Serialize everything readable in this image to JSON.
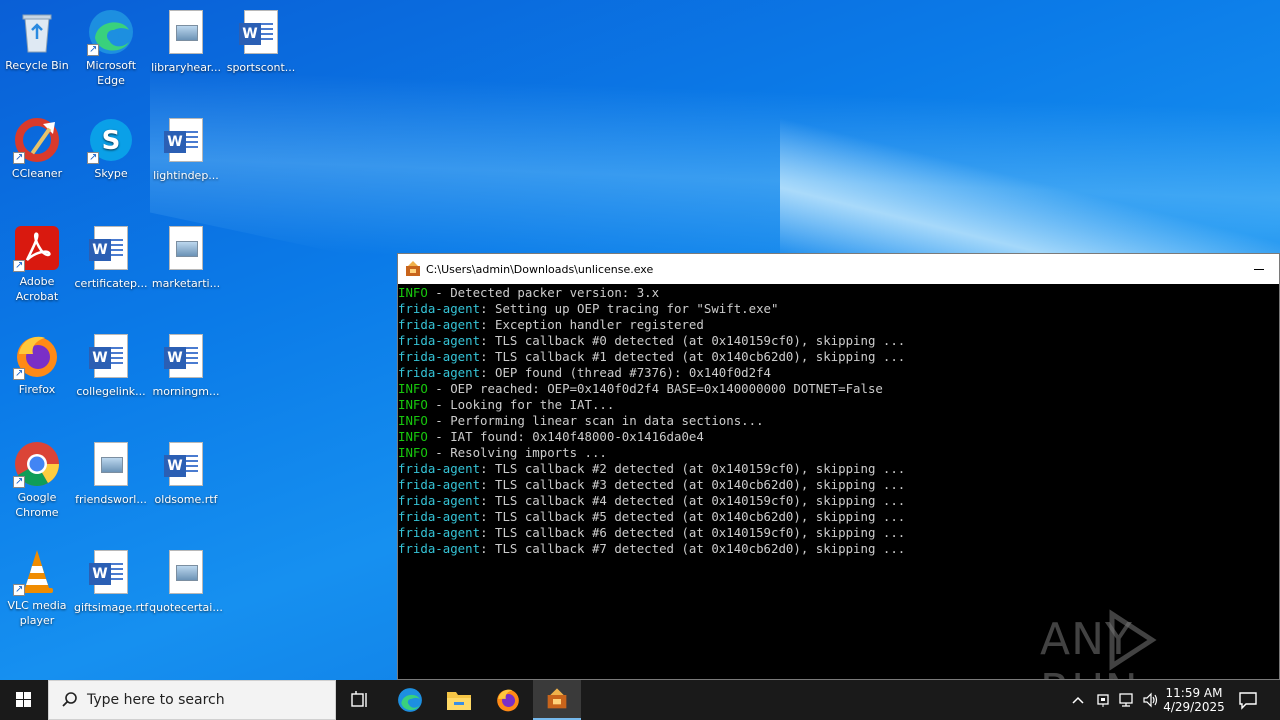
{
  "desktop": {
    "icons": [
      {
        "label": "Recycle Bin"
      },
      {
        "label": "Microsoft Edge"
      },
      {
        "label": "libraryhear..."
      },
      {
        "label": "sportscont..."
      },
      {
        "label": "CCleaner"
      },
      {
        "label": "Skype"
      },
      {
        "label": "lightindep..."
      },
      {
        "label": "Adobe Acrobat"
      },
      {
        "label": "certificatep..."
      },
      {
        "label": "marketarti..."
      },
      {
        "label": "Firefox"
      },
      {
        "label": "collegelink..."
      },
      {
        "label": "morningm..."
      },
      {
        "label": "Google Chrome"
      },
      {
        "label": "friendsworl..."
      },
      {
        "label": "oldsome.rtf"
      },
      {
        "label": "VLC media player"
      },
      {
        "label": "giftsimage.rtf"
      },
      {
        "label": "quotecertai..."
      }
    ]
  },
  "console": {
    "title": "C:\\Users\\admin\\Downloads\\unlicense.exe",
    "lines": [
      {
        "tag": "INFO",
        "text": " - Detected packer version: 3.x"
      },
      {
        "tag": "frida-agent",
        "text": ": Setting up OEP tracing for \"Swift.exe\""
      },
      {
        "tag": "frida-agent",
        "text": ": Exception handler registered"
      },
      {
        "tag": "frida-agent",
        "text": ": TLS callback #0 detected (at 0x140159cf0), skipping ..."
      },
      {
        "tag": "frida-agent",
        "text": ": TLS callback #1 detected (at 0x140cb62d0), skipping ..."
      },
      {
        "tag": "frida-agent",
        "text": ": OEP found (thread #7376): 0x140f0d2f4"
      },
      {
        "tag": "INFO",
        "text": " - OEP reached: OEP=0x140f0d2f4 BASE=0x140000000 DOTNET=False"
      },
      {
        "tag": "INFO",
        "text": " - Looking for the IAT..."
      },
      {
        "tag": "INFO",
        "text": " - Performing linear scan in data sections..."
      },
      {
        "tag": "INFO",
        "text": " - IAT found: 0x140f48000-0x1416da0e4"
      },
      {
        "tag": "INFO",
        "text": " - Resolving imports ..."
      },
      {
        "tag": "frida-agent",
        "text": ": TLS callback #2 detected (at 0x140159cf0), skipping ..."
      },
      {
        "tag": "frida-agent",
        "text": ": TLS callback #3 detected (at 0x140cb62d0), skipping ..."
      },
      {
        "tag": "frida-agent",
        "text": ": TLS callback #4 detected (at 0x140159cf0), skipping ..."
      },
      {
        "tag": "frida-agent",
        "text": ": TLS callback #5 detected (at 0x140cb62d0), skipping ..."
      },
      {
        "tag": "frida-agent",
        "text": ": TLS callback #6 detected (at 0x140159cf0), skipping ..."
      },
      {
        "tag": "frida-agent",
        "text": ": TLS callback #7 detected (at 0x140cb62d0), skipping ..."
      }
    ]
  },
  "watermark": {
    "text": "ANY RUN"
  },
  "taskbar": {
    "search_placeholder": "Type here to search",
    "time": "11:59 AM",
    "date": "4/29/2025"
  },
  "colors": {
    "info": "#17c80d",
    "frida": "#35c3d6"
  }
}
